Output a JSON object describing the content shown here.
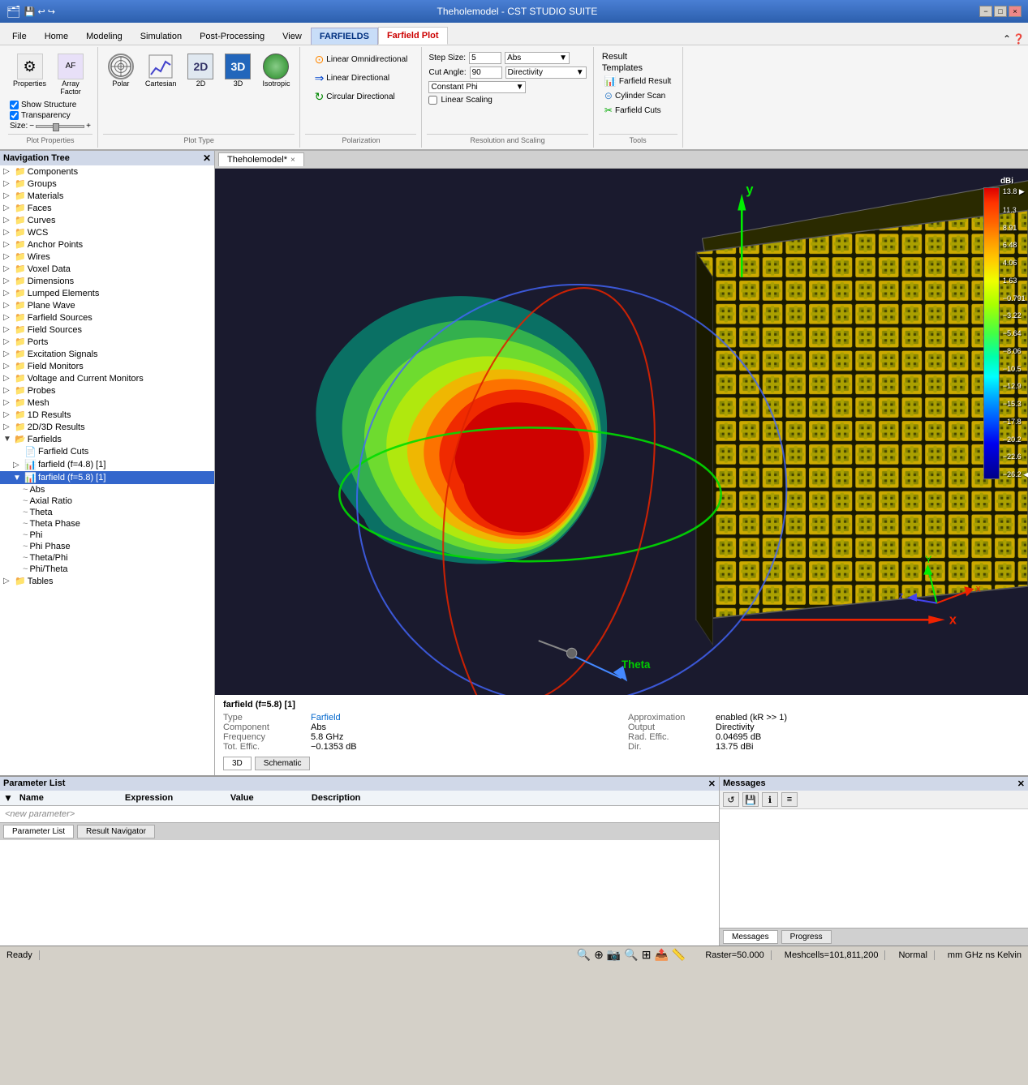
{
  "titlebar": {
    "app_title": "Theholemodel - CST STUDIO SUITE",
    "tabs_left": [
      "FARFIELDS",
      "Farfield Plot"
    ],
    "win_btns": [
      "−",
      "□",
      "×"
    ]
  },
  "ribbon_tabs": [
    {
      "label": "File",
      "active": false
    },
    {
      "label": "Home",
      "active": false
    },
    {
      "label": "Modeling",
      "active": false
    },
    {
      "label": "Simulation",
      "active": false
    },
    {
      "label": "Post-Processing",
      "active": false
    },
    {
      "label": "View",
      "active": false
    },
    {
      "label": "FARFIELDS",
      "active": true,
      "highlight": true
    },
    {
      "label": "Farfield Plot",
      "active": false,
      "highlight": true
    }
  ],
  "ribbon": {
    "groups": {
      "plot_properties": {
        "label": "Plot Properties",
        "properties_btn": "Properties",
        "array_factor_btn": "Array\nFactor",
        "show_structure": "Show Structure",
        "transparency": "Transparency",
        "size_label": "Size:",
        "size_min": "−",
        "size_max": "+"
      },
      "plot_type": {
        "label": "Plot Type",
        "polar": "Polar",
        "cartesian": "Cartesian",
        "d2": "2D",
        "d3": "3D",
        "isotropic": "Isotropic"
      },
      "polarization": {
        "label": "Polarization",
        "linear_omni": "Linear Omnidirectional",
        "linear_dir": "Linear Directional",
        "circular_dir": "Circular Directional"
      },
      "resolution_scaling": {
        "label": "Resolution and Scaling",
        "step_size_label": "Step Size:",
        "step_size_value": "5",
        "cut_angle_label": "Cut Angle:",
        "cut_angle_value": "90",
        "constant_phi": "Constant Phi",
        "abs_label": "Abs",
        "directivity": "Directivity",
        "linear_scaling": "Linear Scaling"
      },
      "result_templates": {
        "label": "Result Templates",
        "farfield_result": "Farfield Result",
        "cylinder_scan": "Cylinder Scan",
        "farfield_cuts": "Farfield Cuts"
      },
      "tools": {
        "label": "Tools"
      }
    }
  },
  "nav_tree": {
    "title": "Navigation Tree",
    "items": [
      {
        "label": "Components",
        "indent": 0,
        "expandable": true
      },
      {
        "label": "Groups",
        "indent": 0,
        "expandable": true
      },
      {
        "label": "Materials",
        "indent": 0,
        "expandable": true
      },
      {
        "label": "Faces",
        "indent": 0,
        "expandable": true
      },
      {
        "label": "Curves",
        "indent": 0,
        "expandable": true
      },
      {
        "label": "WCS",
        "indent": 0,
        "expandable": true
      },
      {
        "label": "Anchor Points",
        "indent": 0,
        "expandable": true
      },
      {
        "label": "Wires",
        "indent": 0,
        "expandable": true
      },
      {
        "label": "Voxel Data",
        "indent": 0,
        "expandable": true
      },
      {
        "label": "Dimensions",
        "indent": 0,
        "expandable": true
      },
      {
        "label": "Lumped Elements",
        "indent": 0,
        "expandable": true
      },
      {
        "label": "Plane Wave",
        "indent": 0,
        "expandable": true
      },
      {
        "label": "Farfield Sources",
        "indent": 0,
        "expandable": true
      },
      {
        "label": "Field Sources",
        "indent": 0,
        "expandable": true
      },
      {
        "label": "Ports",
        "indent": 0,
        "expandable": true
      },
      {
        "label": "Excitation Signals",
        "indent": 0,
        "expandable": true
      },
      {
        "label": "Field Monitors",
        "indent": 0,
        "expandable": true
      },
      {
        "label": "Voltage and Current Monitors",
        "indent": 0,
        "expandable": true
      },
      {
        "label": "Probes",
        "indent": 0,
        "expandable": true
      },
      {
        "label": "Mesh",
        "indent": 0,
        "expandable": true
      },
      {
        "label": "1D Results",
        "indent": 0,
        "expandable": true
      },
      {
        "label": "2D/3D Results",
        "indent": 0,
        "expandable": true
      },
      {
        "label": "Farfields",
        "indent": 0,
        "expandable": true,
        "expanded": true
      },
      {
        "label": "Farfield Cuts",
        "indent": 1,
        "expandable": false
      },
      {
        "label": "farfield (f=4.8) [1]",
        "indent": 1,
        "expandable": true
      },
      {
        "label": "farfield (f=5.8) [1]",
        "indent": 1,
        "expandable": true,
        "expanded": true,
        "selected": true
      },
      {
        "label": "Abs",
        "indent": 2,
        "expandable": false
      },
      {
        "label": "Axial Ratio",
        "indent": 2,
        "expandable": false
      },
      {
        "label": "Theta",
        "indent": 2,
        "expandable": false
      },
      {
        "label": "Theta Phase",
        "indent": 2,
        "expandable": false
      },
      {
        "label": "Phi",
        "indent": 2,
        "expandable": false
      },
      {
        "label": "Phi Phase",
        "indent": 2,
        "expandable": false
      },
      {
        "label": "Theta/Phi",
        "indent": 2,
        "expandable": false
      },
      {
        "label": "Phi/Theta",
        "indent": 2,
        "expandable": false
      },
      {
        "label": "Tables",
        "indent": 0,
        "expandable": true
      }
    ]
  },
  "viewport_tab": {
    "label": "Theholemodel*",
    "close": "×"
  },
  "viewport": {
    "y_axis_label": "y",
    "x_axis_label": "x",
    "theta_label": "Theta",
    "scale_unit": "dBi",
    "scale_values": [
      "13.8",
      "11.3",
      "8.91",
      "6.48",
      "4.06",
      "1.63",
      "−0.791",
      "−3.22",
      "−5.64",
      "−8.06",
      "−10.5",
      "−12.9",
      "−15.3",
      "−17.8",
      "−20.2",
      "−22.6",
      "−26.2"
    ]
  },
  "info_panel": {
    "title": "farfield (f=5.8) [1]",
    "rows": [
      {
        "label": "Type",
        "value": "Farfield",
        "blue": true
      },
      {
        "label": "Approximation",
        "value": "enabled (kR >> 1)"
      },
      {
        "label": "Component",
        "value": "Abs"
      },
      {
        "label": "Output",
        "value": "Directivity"
      },
      {
        "label": "Frequency",
        "value": "5.8 GHz"
      },
      {
        "label": "Rad. Effic.",
        "value": "0.04695 dB"
      },
      {
        "label": "Tot. Effic.",
        "value": "−0.1353 dB"
      },
      {
        "label": "Dir.",
        "value": "13.75 dBi"
      }
    ],
    "tabs": [
      "3D",
      "Schematic"
    ]
  },
  "param_list": {
    "title": "Parameter List",
    "columns": [
      {
        "label": "Name",
        "class": "param-col-name"
      },
      {
        "label": "Expression",
        "class": "param-col-expr"
      },
      {
        "label": "Value",
        "class": "param-col-val"
      },
      {
        "label": "Description",
        "class": "param-col-desc"
      }
    ],
    "new_param_placeholder": "<new parameter>",
    "tabs": [
      "Parameter List",
      "Result Navigator"
    ]
  },
  "messages": {
    "title": "Messages",
    "tabs": [
      "Messages",
      "Progress"
    ]
  },
  "status_bar": {
    "ready": "Ready",
    "raster": "Raster=50.000",
    "meshcells": "Meshcells=101,811,200",
    "normal": "Normal",
    "units": "mm  GHz  ns  Kelvin"
  }
}
